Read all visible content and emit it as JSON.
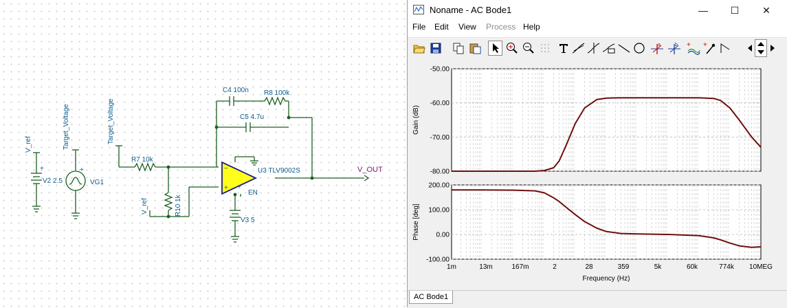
{
  "schematic": {
    "labels": {
      "v_ref_left": "V_ref",
      "target_voltage_left": "Target_Voltage",
      "target_voltage_mid": "Target_Voltage",
      "v_ref_bottom": "V_ref",
      "v_out": "V_OUT"
    },
    "components": {
      "v2": "V2 2.5",
      "vg1": "VG1",
      "r7": "R7 10k",
      "r10": "R10 1k",
      "c4": "C4 100n",
      "r8": "R8 100k",
      "c5": "C5 4.7u",
      "u3": "U3 TLV9002S",
      "en": "EN",
      "v3": "V3 5"
    }
  },
  "window": {
    "title": "Noname - AC Bode1",
    "controls": {
      "minimize": "—",
      "maximize": "☐",
      "close": "✕"
    },
    "menu": [
      {
        "label": "File",
        "enabled": true
      },
      {
        "label": "Edit",
        "enabled": true
      },
      {
        "label": "View",
        "enabled": true
      },
      {
        "label": "Process",
        "enabled": false
      },
      {
        "label": "Help",
        "enabled": true
      }
    ],
    "toolbar_icons": [
      "open-icon",
      "save-icon",
      "copy-icon",
      "paste-icon",
      "pointer-icon",
      "zoom-in-icon",
      "zoom-100-icon",
      "grid-icon",
      "text-icon",
      "tangent-icon",
      "cursor-icon",
      "label-icon",
      "line-icon",
      "circle-icon",
      "cursor-a-icon",
      "cursor-b-icon",
      "curves-icon",
      "marker-icon",
      "flag-icon",
      "scroll-left-icon",
      "scroll-up-down-icon",
      "scroll-right-icon"
    ],
    "tab": "AC Bode1"
  },
  "chart_data": [
    {
      "type": "line",
      "title": "",
      "xlabel": "",
      "ylabel": "Gain (dB)",
      "x_scale": "log",
      "x": [
        0.001,
        0.01,
        0.1,
        0.5,
        1,
        2,
        3,
        5,
        10,
        20,
        50,
        100,
        300,
        1000,
        10000,
        100000,
        300000,
        500000,
        1000000,
        2000000,
        5000000,
        10000000
      ],
      "series": [
        {
          "values": [
            -80,
            -80,
            -80,
            -80,
            -79.8,
            -79,
            -77,
            -72.5,
            -66,
            -61.5,
            -59,
            -58.6,
            -58.5,
            -58.5,
            -58.5,
            -58.5,
            -58.7,
            -59.3,
            -61.5,
            -65,
            -70,
            -73
          ]
        }
      ],
      "ylim": [
        -80,
        -50
      ],
      "yticks": [
        "-50.00",
        "-60.00",
        "-70.00",
        "-80.00"
      ],
      "grid": true,
      "color": "#6e0d0d"
    },
    {
      "type": "line",
      "title": "",
      "xlabel": "Frequency (Hz)",
      "ylabel": "Phase [deg]",
      "x_scale": "log",
      "xlim": [
        0.001,
        10000000
      ],
      "xticks": [
        "1m",
        "13m",
        "167m",
        "2",
        "28",
        "359",
        "5k",
        "60k",
        "774k",
        "10MEG"
      ],
      "x": [
        0.001,
        0.01,
        0.1,
        0.5,
        1,
        2,
        3,
        5,
        10,
        20,
        50,
        100,
        300,
        1000,
        10000,
        100000,
        300000,
        500000,
        1000000,
        2000000,
        5000000,
        10000000
      ],
      "series": [
        {
          "values": [
            180,
            180,
            179,
            176,
            168,
            148,
            133,
            110,
            80,
            52,
            25,
            12,
            4,
            2,
            0,
            -5,
            -14,
            -22,
            -35,
            -46,
            -52,
            -50
          ]
        }
      ],
      "ylim": [
        -100,
        200
      ],
      "yticks": [
        "200.00",
        "100.00",
        "0.00",
        "-100.00"
      ],
      "grid": true,
      "color": "#6e0d0d"
    }
  ]
}
